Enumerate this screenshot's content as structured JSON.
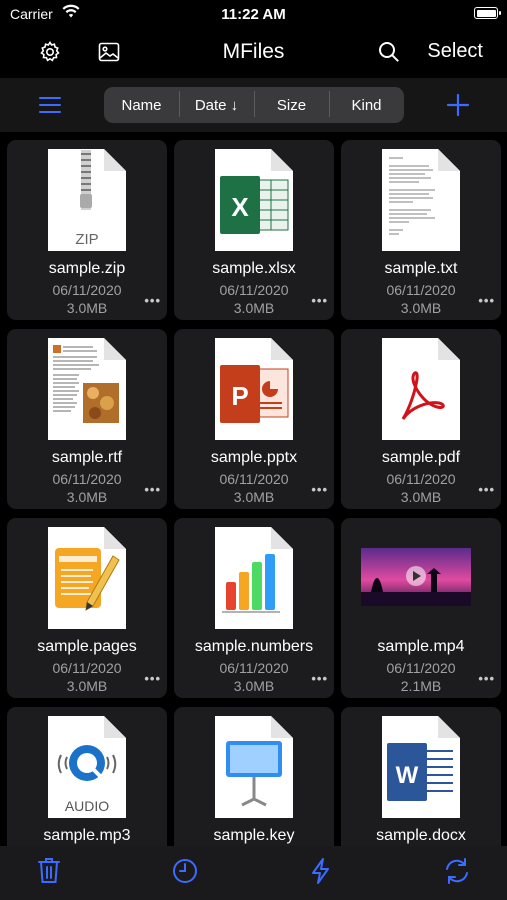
{
  "status": {
    "carrier": "Carrier",
    "time": "11:22 AM"
  },
  "nav": {
    "title": "MFiles",
    "select_label": "Select",
    "icons": [
      "gear-icon",
      "image-icon",
      "search-icon"
    ]
  },
  "sort": {
    "segments": [
      "Name",
      "Date ↓",
      "Size",
      "Kind"
    ],
    "active": "Date ↓"
  },
  "colors": {
    "accent": "#3b6cff",
    "card": "#1c1c1e",
    "toolbar": "#161616"
  },
  "files": [
    {
      "name": "sample.zip",
      "date": "06/11/2020",
      "size": "3.0MB",
      "icon": "zip-icon",
      "thumb_label": "ZIP"
    },
    {
      "name": "sample.xlsx",
      "date": "06/11/2020",
      "size": "3.0MB",
      "icon": "excel-icon",
      "thumb_label": "X"
    },
    {
      "name": "sample.txt",
      "date": "06/11/2020",
      "size": "3.0MB",
      "icon": "text-document-icon"
    },
    {
      "name": "sample.rtf",
      "date": "06/11/2020",
      "size": "3.0MB",
      "icon": "rtf-document-icon"
    },
    {
      "name": "sample.pptx",
      "date": "06/11/2020",
      "size": "3.0MB",
      "icon": "powerpoint-icon",
      "thumb_label": "P"
    },
    {
      "name": "sample.pdf",
      "date": "06/11/2020",
      "size": "3.0MB",
      "icon": "pdf-icon"
    },
    {
      "name": "sample.pages",
      "date": "06/11/2020",
      "size": "3.0MB",
      "icon": "pages-icon"
    },
    {
      "name": "sample.numbers",
      "date": "06/11/2020",
      "size": "3.0MB",
      "icon": "numbers-icon"
    },
    {
      "name": "sample.mp4",
      "date": "06/11/2020",
      "size": "2.1MB",
      "icon": "video-thumbnail-icon"
    },
    {
      "name": "sample.mp3",
      "date": "",
      "size": "",
      "icon": "audio-icon",
      "thumb_label": "AUDIO"
    },
    {
      "name": "sample.key",
      "date": "",
      "size": "",
      "icon": "keynote-icon"
    },
    {
      "name": "sample.docx",
      "date": "",
      "size": "",
      "icon": "word-icon",
      "thumb_label": "W"
    }
  ],
  "tabbar": {
    "icons": [
      "trash-icon",
      "clock-icon",
      "lightning-icon",
      "refresh-icon"
    ]
  }
}
